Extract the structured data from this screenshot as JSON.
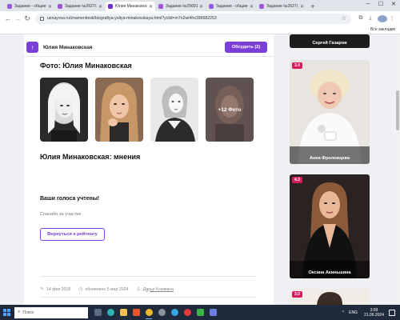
{
  "browser": {
    "tabs": [
      {
        "label": "Задание - общие з",
        "active": false
      },
      {
        "label": "Задание №2627/...",
        "active": false
      },
      {
        "label": "Юлия Минаковская",
        "active": true
      },
      {
        "label": "Задание №25691",
        "active": false
      },
      {
        "label": "Задание - общие з",
        "active": false
      },
      {
        "label": "Задание №2627/...",
        "active": false
      }
    ],
    "url": "uznayvsa.ru/znamenitosti/biografiya-yuliya-minakovskaya.html?yclid=m7n2wi4hs396582253",
    "all_bookmarks": "Все закладки"
  },
  "page": {
    "sticky_name": "Юлия Минаковская",
    "discuss_label": "Обсудить (2)",
    "photo_title": "Фото: Юлия Минаковская",
    "more_photos": "+12 Фото",
    "opinions_title": "Юлия Минаковская: мнения",
    "votes_title": "Ваши голоса учтены!",
    "thanks_text": "Спасибо за участие",
    "rating_button": "Вернуться к рейтингу",
    "meta": {
      "date": "14 фев 2018",
      "updated": "обновлено 5 мар 2024",
      "author": "Дарья Козякина"
    }
  },
  "sidebar": [
    {
      "name": "Сергей Газаров",
      "score": ""
    },
    {
      "name": "Анна Фроловцева",
      "score": "3.4"
    },
    {
      "name": "Оксана Акиньшина",
      "score": "4.3"
    },
    {
      "name": "",
      "score": "3.0"
    }
  ],
  "taskbar": {
    "search_placeholder": "Поиск",
    "lang": "ENG",
    "time": "3:09",
    "date": "21.06.2024"
  },
  "colors": {
    "accent": "#7b3fd8",
    "score_badge": "#d81b60",
    "taskbar": "#1f2b3d"
  }
}
